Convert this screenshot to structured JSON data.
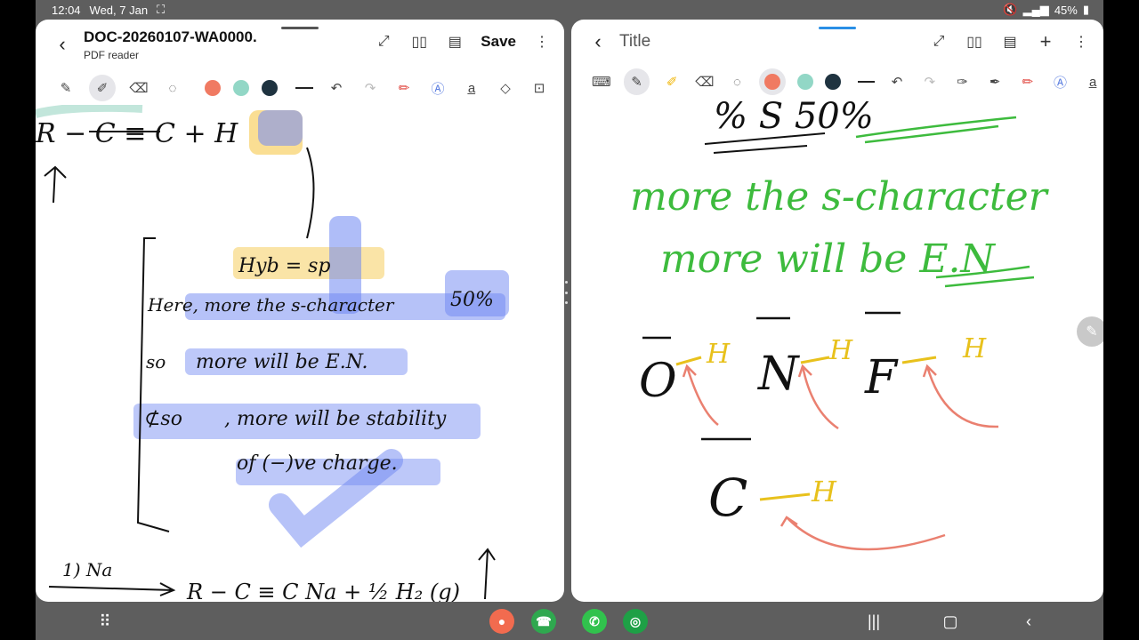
{
  "status_bar": {
    "time": "12:04",
    "date": "Wed, 7 Jan",
    "battery": "45%"
  },
  "left_app": {
    "title": "DOC-20260107-WA0000.",
    "subtitle": "PDF reader",
    "save_label": "Save",
    "colors": {
      "coral": "#f07a62",
      "teal": "#92d7c6",
      "dark": "#1f3340"
    }
  },
  "right_app": {
    "title": "Title",
    "colors": {
      "coral": "#f07a62",
      "teal": "#92d7c6",
      "dark": "#1f3340"
    }
  },
  "left_notes": {
    "reaction_top": "R − C ≡ C + H",
    "hyb": "Hyb = sp",
    "line1": "Here, more the s-character",
    "pct": "50%",
    "line2_prefix": "so",
    "line2": "more will be E.N.",
    "line3_prefix": "⊄so",
    "line3": ", more will be stability",
    "line4": "of (−)ve charge.",
    "reaction_bottom_reagent": "1) Na",
    "reaction_bottom": "R − C ≡ C Na + ½ H₂ (g)"
  },
  "right_notes": {
    "top_partial": "% S   50%",
    "line1": "more the s-character",
    "line2": "more will be E.N",
    "ions": [
      "O",
      "N",
      "F",
      "C"
    ],
    "h_label": "H"
  },
  "dock": [
    "people-app",
    "phone-app",
    "whatsapp-app",
    "green-app"
  ]
}
